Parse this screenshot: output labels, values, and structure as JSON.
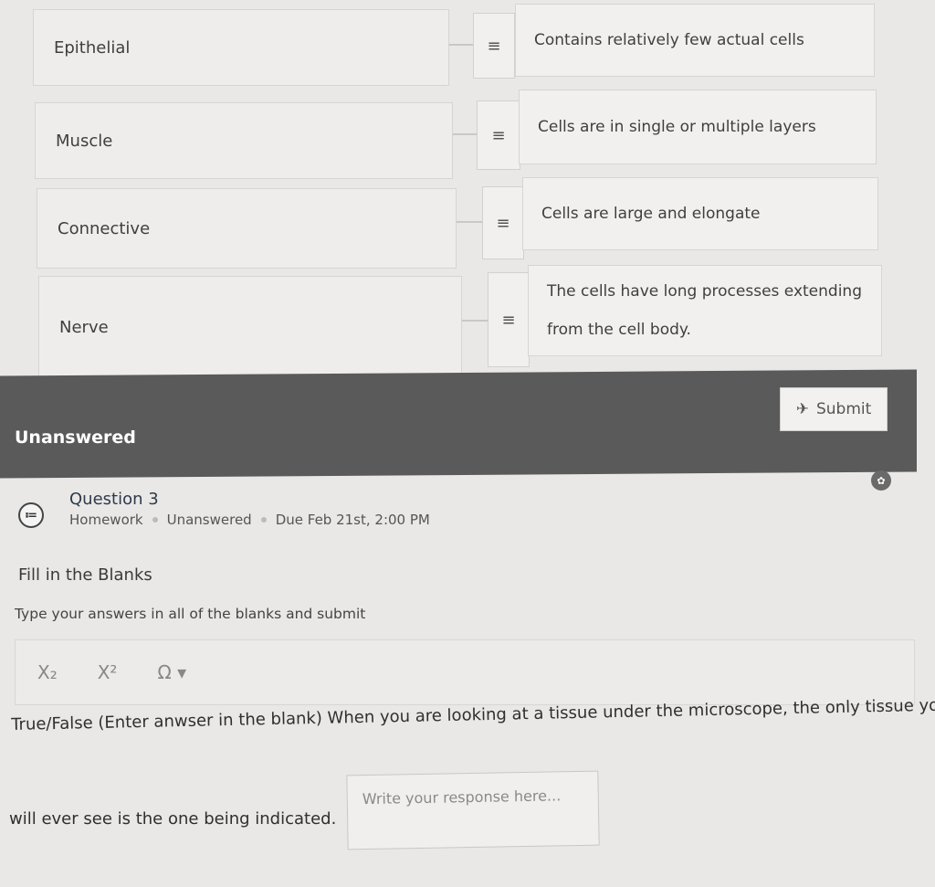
{
  "matching": {
    "terms": [
      "Epithelial",
      "Muscle",
      "Connective",
      "Nerve"
    ],
    "definitions": [
      "Contains relatively few actual cells",
      "Cells are in single or multiple layers",
      "Cells are large and elongate",
      "The cells have long processes extending from the cell body."
    ],
    "handle_glyph": "≡"
  },
  "status": {
    "label": "Unanswered",
    "submit_label": "Submit",
    "submit_icon": "✈"
  },
  "question": {
    "icon_glyph": "≔",
    "title": "Question 3",
    "meta": [
      "Homework",
      "Unanswered",
      "Due Feb 21st, 2:00 PM"
    ],
    "type_title": "Fill in the Blanks",
    "instruction": "Type your answers in all of the blanks and submit",
    "toolbar": {
      "subscript": "X₂",
      "superscript": "X²",
      "special_chars": "Ω ▾"
    },
    "text_part1": "True/False (Enter anwser in the blank) When you are looking at a tissue under the microscope, the only tissue you",
    "text_part2": "will ever see is the one being indicated.",
    "response_placeholder": "Write your response here..."
  }
}
